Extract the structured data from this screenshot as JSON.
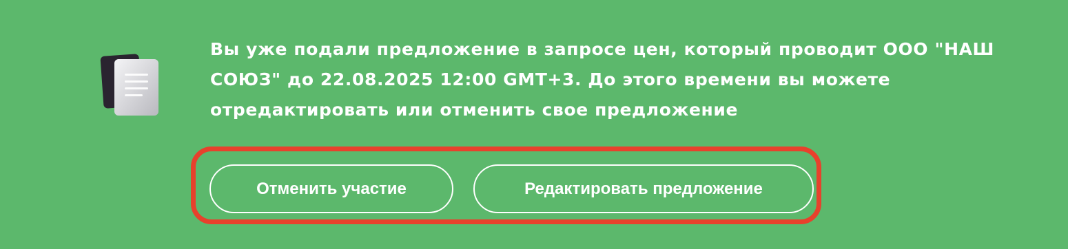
{
  "banner": {
    "icon": "document-icon",
    "message": "Вы уже подали предложение в запросе цен, который проводит ООО \"НАШ СОЮЗ\" до 22.08.2025 12:00 GMT+3. До этого времени вы можете отредактировать или отменить свое предложение",
    "background_color": "#5cb86c"
  },
  "actions": {
    "cancel_label": "Отменить участие",
    "edit_label": "Редактировать предложение",
    "highlight_color": "#e8412c"
  }
}
